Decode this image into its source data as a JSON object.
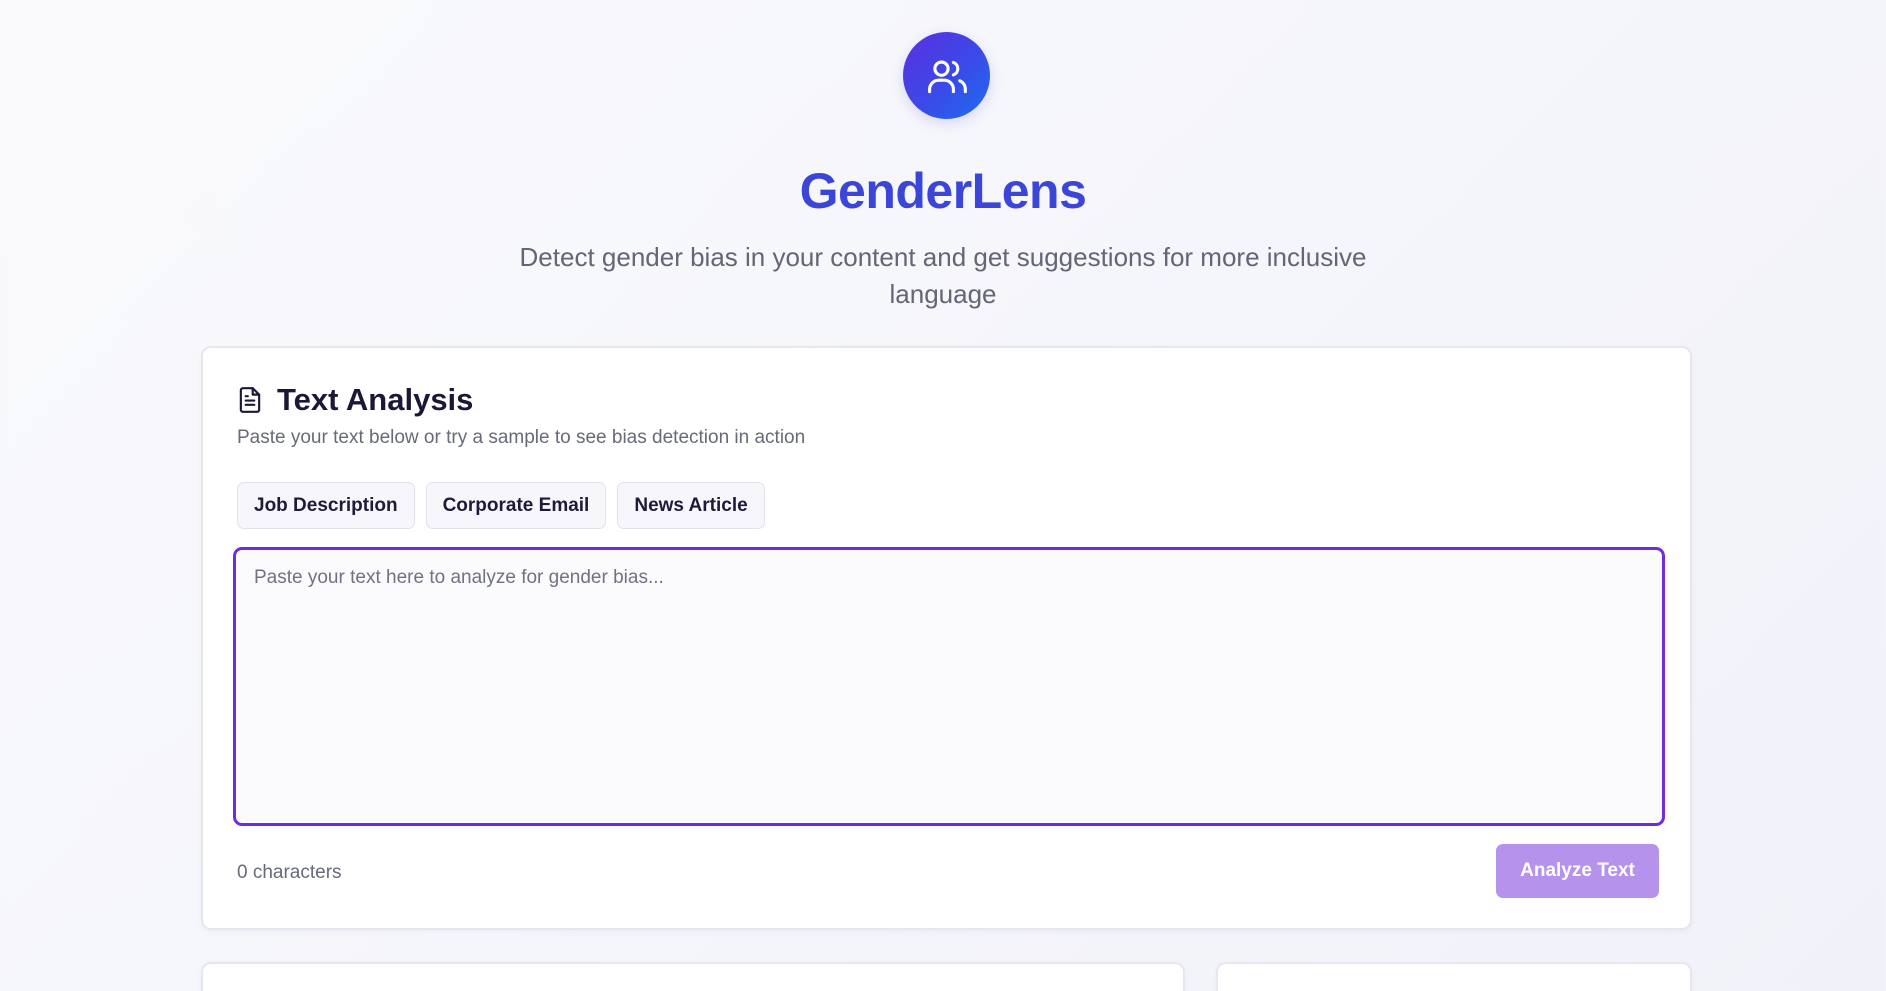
{
  "app": {
    "title": "GenderLens",
    "subtitle": "Detect gender bias in your content and get suggestions for more inclusive language",
    "logo_icon": "users-icon",
    "brand_color": "#3b45d8"
  },
  "analysis_card": {
    "icon": "document-icon",
    "title": "Text Analysis",
    "description": "Paste your text below or try a sample to see bias detection in action",
    "samples": [
      {
        "label": "Job Description"
      },
      {
        "label": "Corporate Email"
      },
      {
        "label": "News Article"
      }
    ],
    "input": {
      "value": "",
      "placeholder": "Paste your text here to analyze for gender bias..."
    },
    "char_count": "0 characters",
    "analyze_label": "Analyze Text",
    "accent_color": "#6d2ddc",
    "button_color": "#b592ec"
  }
}
